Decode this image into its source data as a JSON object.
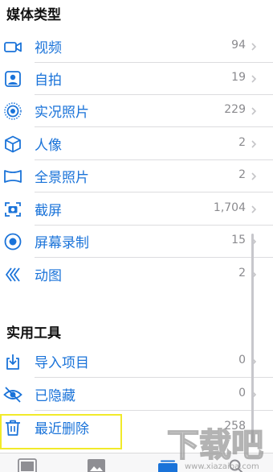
{
  "media_types": {
    "title": "媒体类型",
    "items": [
      {
        "label": "视频",
        "count": "94",
        "icon": "video-icon"
      },
      {
        "label": "自拍",
        "count": "19",
        "icon": "selfie-icon"
      },
      {
        "label": "实况照片",
        "count": "229",
        "icon": "live-photo-icon"
      },
      {
        "label": "人像",
        "count": "2",
        "icon": "portrait-cube-icon"
      },
      {
        "label": "全景照片",
        "count": "2",
        "icon": "panorama-icon"
      },
      {
        "label": "截屏",
        "count": "1,704",
        "icon": "screenshot-icon"
      },
      {
        "label": "屏幕录制",
        "count": "15",
        "icon": "screen-recording-icon"
      },
      {
        "label": "动图",
        "count": "2",
        "icon": "animated-icon"
      }
    ]
  },
  "utilities": {
    "title": "实用工具",
    "items": [
      {
        "label": "导入项目",
        "count": "0",
        "icon": "import-icon"
      },
      {
        "label": "已隐藏",
        "count": "0",
        "icon": "hidden-eye-icon"
      },
      {
        "label": "最近删除",
        "count": "258",
        "icon": "trash-icon"
      }
    ]
  },
  "tabbar": {
    "tabs": [
      {
        "name": "photos-tab",
        "icon": "photos-icon"
      },
      {
        "name": "for-you-tab",
        "icon": "memories-icon"
      },
      {
        "name": "albums-tab",
        "icon": "albums-icon"
      },
      {
        "name": "search-tab",
        "icon": "search-icon"
      }
    ]
  },
  "watermark": {
    "brand": "下载吧",
    "url": "www.xiazaiba.com"
  },
  "colors": {
    "accent": "#1a73d9",
    "highlight_box": "#f1ea2a",
    "count_text": "#8a8a8e"
  }
}
